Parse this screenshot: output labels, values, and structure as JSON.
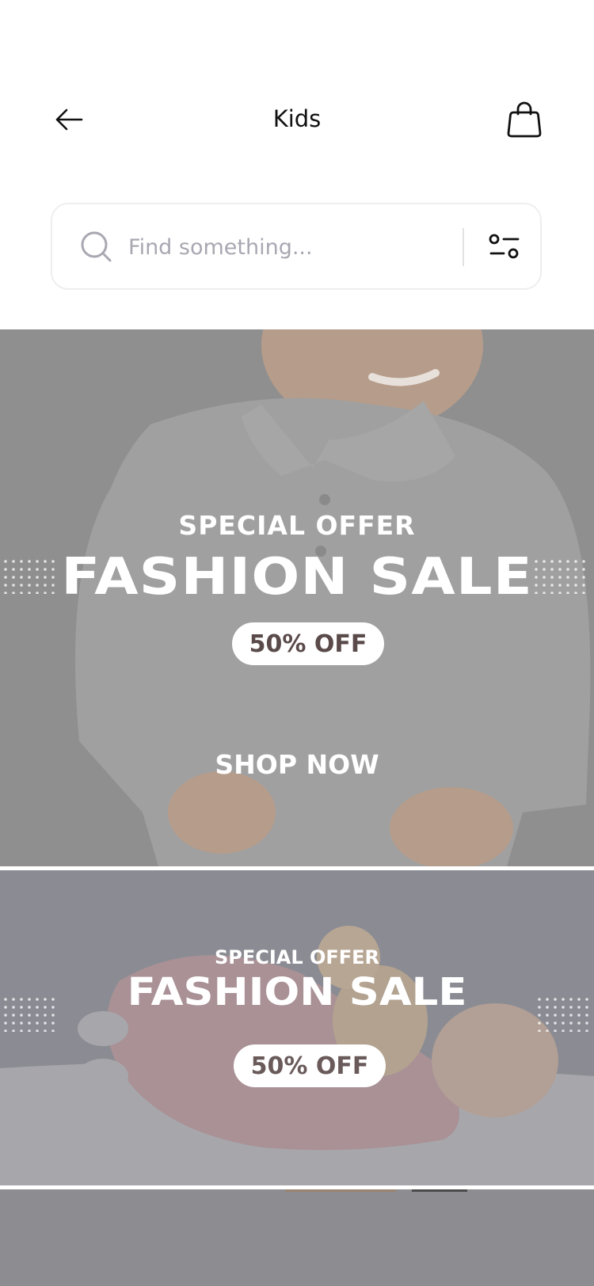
{
  "header": {
    "title": "Kids",
    "back_icon": "arrow-left-icon",
    "bag_icon": "shopping-bag-icon"
  },
  "search": {
    "placeholder": "Find something...",
    "icon": "search-icon",
    "filter_icon": "filter-sliders-icon"
  },
  "banners": [
    {
      "subtitle": "SPECIAL OFFER",
      "headline": "FASHION SALE",
      "discount": "50% OFF",
      "cta": "SHOP NOW"
    },
    {
      "subtitle": "SPECIAL OFFER",
      "headline": "FASHION SALE",
      "discount": "50% OFF"
    }
  ],
  "colors": {
    "banner_overlay": "#8e8e8e",
    "pill_text": "#5a4a4a"
  }
}
